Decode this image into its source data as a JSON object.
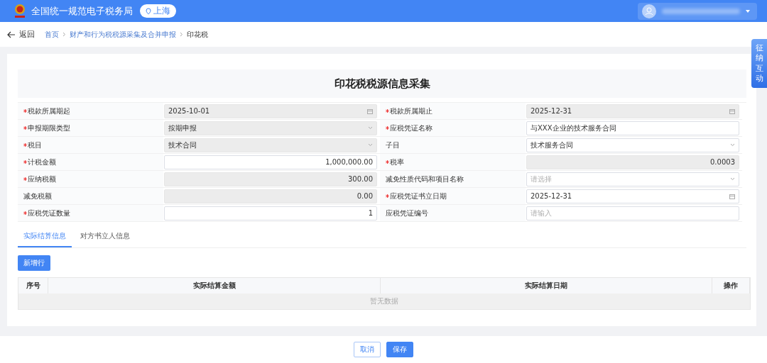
{
  "header": {
    "title": "全国统一规范电子税务局",
    "region": "上海"
  },
  "nav": {
    "back": "返回",
    "breadcrumb": [
      {
        "label": "首页",
        "link": true
      },
      {
        "label": "财产和行为税税源采集及合并申报",
        "link": true
      },
      {
        "label": "印花税",
        "link": false
      }
    ]
  },
  "side_tab": {
    "label": "征纳互动"
  },
  "form": {
    "title": "印花税税源信息采集",
    "rows": [
      [
        {
          "label": "税款所属期起",
          "required": true,
          "kind": "date",
          "value": "2025-10-01",
          "disabled": true
        },
        {
          "label": "税款所属期止",
          "required": true,
          "kind": "date",
          "value": "2025-12-31",
          "disabled": true
        }
      ],
      [
        {
          "label": "申报期限类型",
          "required": true,
          "kind": "select",
          "value": "按期申报",
          "disabled": true
        },
        {
          "label": "应税凭证名称",
          "required": true,
          "kind": "text",
          "value": "与XXX企业的技术服务合同",
          "disabled": false
        }
      ],
      [
        {
          "label": "税目",
          "required": true,
          "kind": "select",
          "value": "技术合同",
          "disabled": true
        },
        {
          "label": "子目",
          "required": false,
          "kind": "select",
          "value": "技术服务合同",
          "disabled": false
        }
      ],
      [
        {
          "label": "计税金额",
          "required": true,
          "kind": "number",
          "value": "1,000,000.00",
          "disabled": false
        },
        {
          "label": "税率",
          "required": true,
          "kind": "number",
          "value": "0.0003",
          "disabled": true
        }
      ],
      [
        {
          "label": "应纳税额",
          "required": true,
          "kind": "number",
          "value": "300.00",
          "disabled": true
        },
        {
          "label": "减免性质代码和项目名称",
          "required": false,
          "kind": "select",
          "placeholder": "请选择",
          "disabled": false
        }
      ],
      [
        {
          "label": "减免税额",
          "required": false,
          "kind": "number",
          "value": "0.00",
          "disabled": true
        },
        {
          "label": "应税凭证书立日期",
          "required": true,
          "kind": "date",
          "value": "2025-12-31",
          "disabled": false
        }
      ],
      [
        {
          "label": "应税凭证数量",
          "required": true,
          "kind": "number",
          "value": "1",
          "disabled": false
        },
        {
          "label": "应税凭证编号",
          "required": false,
          "kind": "text",
          "placeholder": "请输入",
          "disabled": false
        }
      ]
    ]
  },
  "tabs": [
    {
      "label": "实际结算信息",
      "selected": true
    },
    {
      "label": "对方书立人信息",
      "selected": false
    }
  ],
  "add_button": "新增行",
  "table": {
    "columns": [
      "序号",
      "实际结算金额",
      "实际结算日期",
      "操作"
    ],
    "empty_text": "暂无数据"
  },
  "footer": {
    "buttons": [
      {
        "label": "取消",
        "kind": "secondary"
      },
      {
        "label": "保存",
        "kind": "primary"
      }
    ]
  }
}
